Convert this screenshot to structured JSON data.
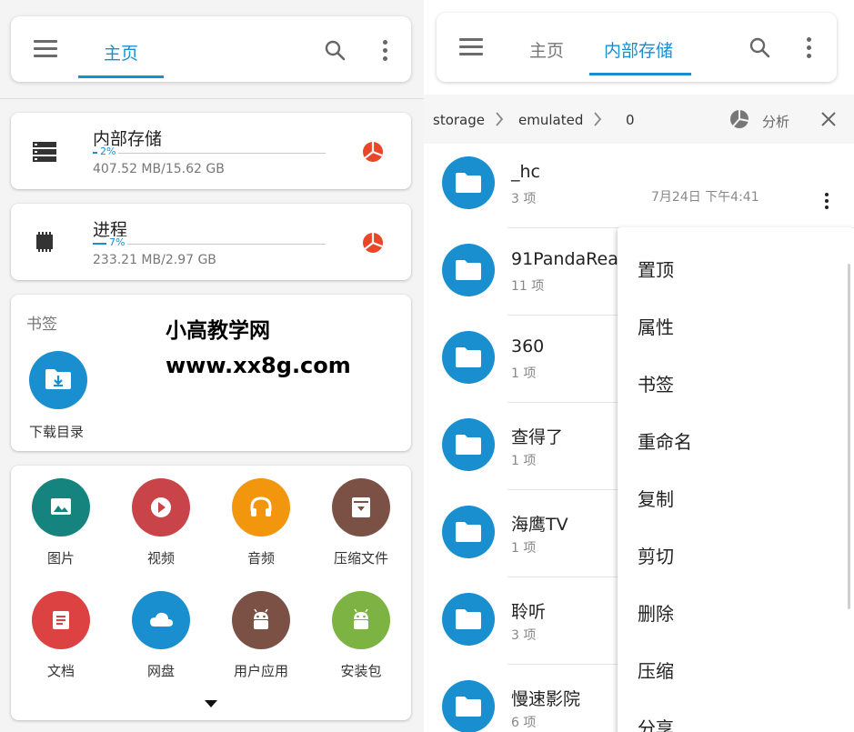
{
  "left": {
    "toolbar": {
      "tab": "主页"
    },
    "storage": {
      "title": "内部存储",
      "percent": "2%",
      "usage": "407.52 MB/15.62 GB",
      "fraction": 0.02
    },
    "process": {
      "title": "进程",
      "percent": "7%",
      "usage": "233.21 MB/2.97 GB",
      "fraction": 0.07
    },
    "bookmarks": {
      "heading": "书签",
      "item_label": "下载目录"
    },
    "watermark": {
      "line1": "小高教学网",
      "line2": "www.xx8g.com"
    },
    "categories": [
      {
        "label": "图片",
        "icon": "image-icon",
        "color": "#15847f"
      },
      {
        "label": "视频",
        "icon": "play-icon",
        "color": "#c94448"
      },
      {
        "label": "音频",
        "icon": "headphones-icon",
        "color": "#f2960e"
      },
      {
        "label": "压缩文件",
        "icon": "archive-icon",
        "color": "#7b5146"
      },
      {
        "label": "文档",
        "icon": "document-icon",
        "color": "#dc4242"
      },
      {
        "label": "网盘",
        "icon": "cloud-icon",
        "color": "#1a8fd0"
      },
      {
        "label": "用户应用",
        "icon": "android-icon",
        "color": "#7b5146"
      },
      {
        "label": "安装包",
        "icon": "android-icon",
        "color": "#7cb342"
      }
    ]
  },
  "right": {
    "toolbar": {
      "tab_home": "主页",
      "tab_storage": "内部存储"
    },
    "breadcrumb": {
      "items": [
        "storage",
        "emulated",
        "0"
      ],
      "analyze": "分析"
    },
    "folders": [
      {
        "name": "_hc",
        "count": "3 项",
        "date": "7月24日 下午4:41"
      },
      {
        "name": "91PandaRea",
        "count": "11 项"
      },
      {
        "name": "360",
        "count": "1 项"
      },
      {
        "name": "查得了",
        "count": "1 项"
      },
      {
        "name": "海鹰TV",
        "count": "1 项"
      },
      {
        "name": "聆听",
        "count": "3 项"
      },
      {
        "name": "慢速影院",
        "count": "6 项"
      }
    ],
    "menu": [
      "置顶",
      "属性",
      "书签",
      "重命名",
      "复制",
      "剪切",
      "删除",
      "压缩",
      "分享"
    ]
  },
  "colors": {
    "accent": "#1a8fd0",
    "pie": "#e8472a"
  }
}
